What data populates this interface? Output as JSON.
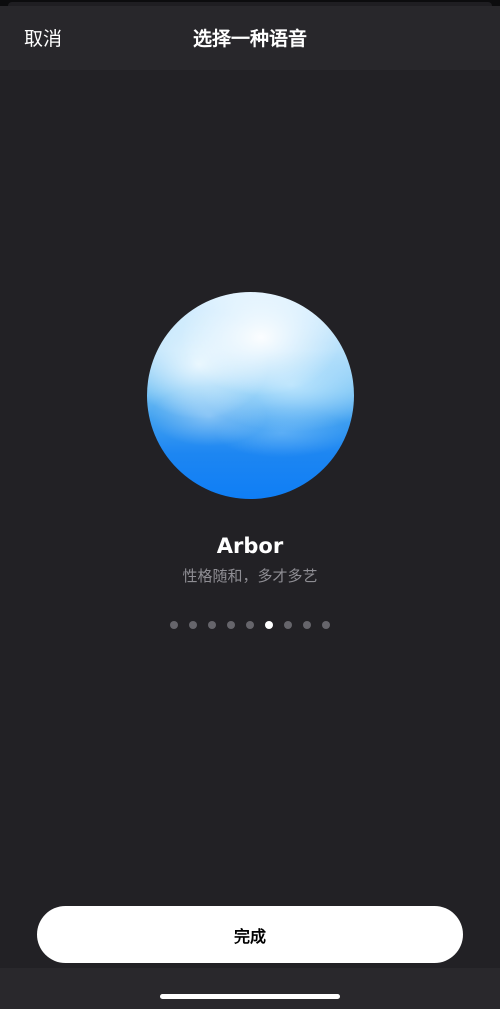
{
  "header": {
    "cancel_label": "取消",
    "title": "选择一种语音"
  },
  "voice": {
    "name": "Arbor",
    "description": "性格随和，多才多艺",
    "orb_icon": "sky-orb-icon",
    "colors": {
      "orb_top": "#dff2ff",
      "orb_bottom": "#0f7ef5"
    }
  },
  "pager": {
    "total": 9,
    "current": 6
  },
  "footer": {
    "done_label": "完成"
  },
  "theme": {
    "background": "#222125",
    "header_background": "#28272b",
    "secondary_text": "#8e8d93"
  }
}
